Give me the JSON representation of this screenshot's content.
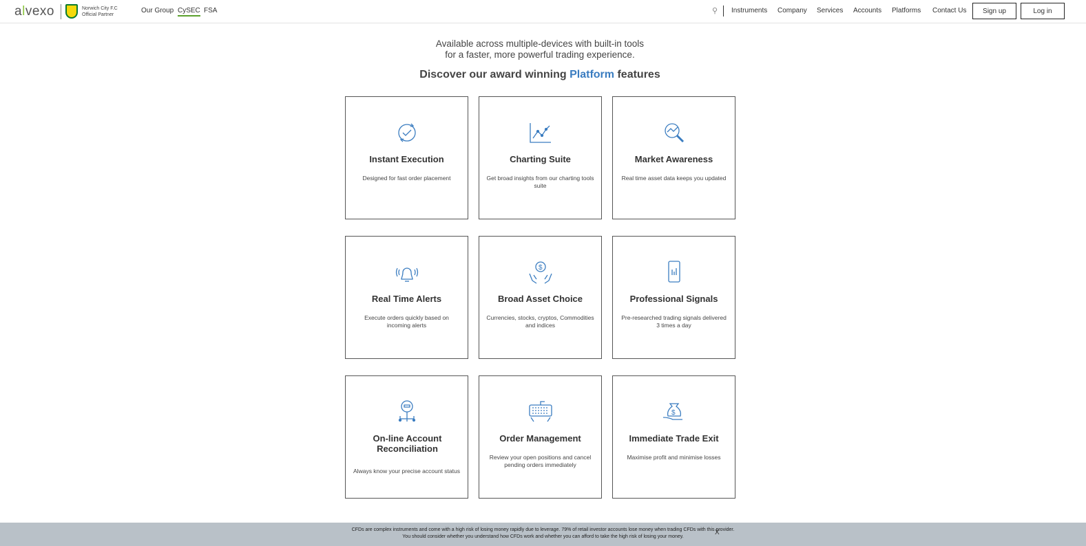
{
  "nav": {
    "logo": "alvexo",
    "partner_line1": "Norwich City F.C",
    "partner_line2": "Official Partner",
    "left_links": [
      "Our Group",
      "CySEC",
      "FSA"
    ],
    "right_links": [
      "Instruments",
      "Company",
      "Services",
      "Accounts",
      "Platforms",
      "Contact Us"
    ],
    "signup": "Sign up",
    "login": "Log in"
  },
  "intro": {
    "line1": "Available across multiple-devices with built-in tools",
    "line2": "for a faster, more powerful trading experience."
  },
  "heading": {
    "pre": "Discover our award winning ",
    "accent": "Platform",
    "post": " features"
  },
  "accent_color": "#3a7cc0",
  "features": [
    {
      "icon": "refresh-check-icon",
      "title": "Instant Execution",
      "desc": "Designed for fast order placement"
    },
    {
      "icon": "line-chart-icon",
      "title": "Charting Suite",
      "desc": "Get broad insights from our charting tools suite"
    },
    {
      "icon": "magnifier-chart-icon",
      "title": "Market Awareness",
      "desc": "Real time asset data keeps you updated"
    },
    {
      "icon": "bell-icon",
      "title": "Real Time Alerts",
      "desc": "Execute orders quickly based on incoming alerts"
    },
    {
      "icon": "hands-dollar-icon",
      "title": "Broad Asset Choice",
      "desc": "Currencies, stocks, cryptos, Commodities and indices"
    },
    {
      "icon": "phone-signal-icon",
      "title": "Professional Signals",
      "desc": "Pre-researched trading signals delivered 3 times a day"
    },
    {
      "icon": "account-network-icon",
      "title": "On-line Account Reconciliation",
      "desc": "Always know your precise account status"
    },
    {
      "icon": "keyboard-hands-icon",
      "title": "Order Management",
      "desc": "Review your open positions and cancel pending orders immediately"
    },
    {
      "icon": "money-bag-hand-icon",
      "title": "Immediate Trade Exit",
      "desc": "Maximise profit and minimise losses"
    }
  ],
  "risk": {
    "line1": "CFDs are complex instruments and come with a high risk of losing money rapidly due to leverage. 79% of retail investor accounts lose money when trading CFDs with this provider.",
    "line2": "You should consider whether you understand how CFDs work and whether you can afford to take the high risk of losing your money.",
    "close": "X"
  }
}
